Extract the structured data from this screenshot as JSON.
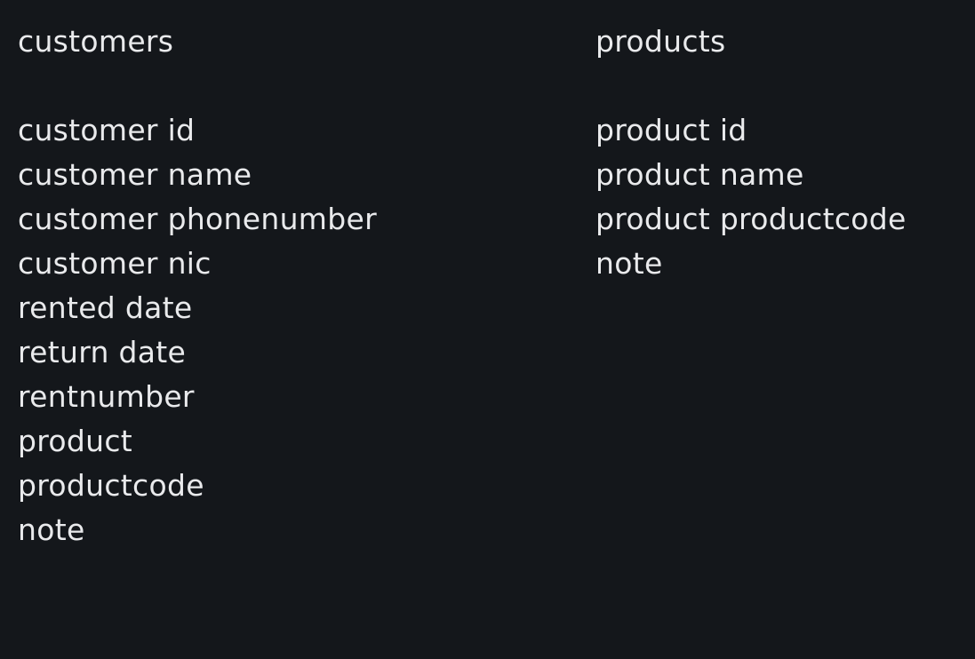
{
  "customers": {
    "title": "customers",
    "fields": [
      "customer id",
      "customer name",
      "customer phonenumber",
      "customer nic",
      "rented date",
      "return date",
      "rentnumber",
      "product",
      "productcode",
      "note"
    ]
  },
  "products": {
    "title": "products",
    "fields": [
      "product id",
      "product name",
      "product productcode",
      "note"
    ]
  },
  "colors": {
    "background": "#14171b",
    "text": "#e9eaec"
  }
}
